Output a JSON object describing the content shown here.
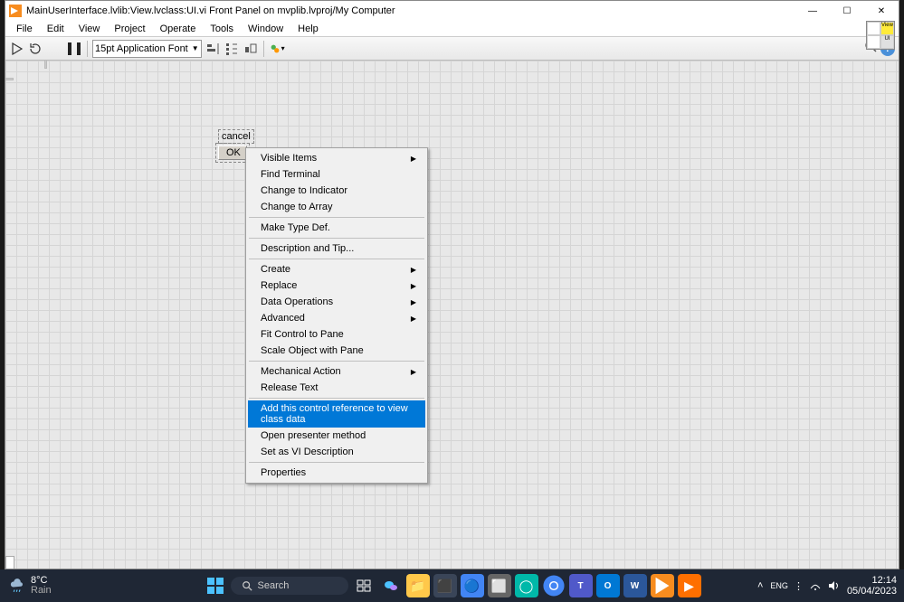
{
  "window": {
    "title": "MainUserInterface.lvlib:View.lvclass:UI.vi Front Panel on mvplib.lvproj/My Computer"
  },
  "menu": {
    "file": "File",
    "edit": "Edit",
    "view": "View",
    "project": "Project",
    "operate": "Operate",
    "tools": "Tools",
    "window": "Window",
    "help": "Help"
  },
  "toolbar": {
    "font_label": "15pt Application Font",
    "palette_top": "View",
    "palette_bottom": "UI"
  },
  "control": {
    "label": "cancel",
    "button": "OK"
  },
  "context_menu": {
    "items": [
      {
        "label": "Visible Items",
        "sub": true
      },
      {
        "label": "Find Terminal"
      },
      {
        "label": "Change to Indicator"
      },
      {
        "label": "Change to Array"
      },
      {
        "sep": true
      },
      {
        "label": "Make Type Def."
      },
      {
        "sep": true
      },
      {
        "label": "Description and Tip..."
      },
      {
        "sep": true
      },
      {
        "label": "Create",
        "sub": true
      },
      {
        "label": "Replace",
        "sub": true
      },
      {
        "label": "Data Operations",
        "sub": true
      },
      {
        "label": "Advanced",
        "sub": true
      },
      {
        "label": "Fit Control to Pane"
      },
      {
        "label": "Scale Object with Pane"
      },
      {
        "sep": true
      },
      {
        "label": "Mechanical Action",
        "sub": true
      },
      {
        "label": "Release Text"
      },
      {
        "sep": true
      },
      {
        "label": "Add this control reference to view class data",
        "hl": true
      },
      {
        "label": "Open presenter method"
      },
      {
        "label": "Set as VI Description"
      },
      {
        "sep": true
      },
      {
        "label": "Properties"
      }
    ]
  },
  "taskbar": {
    "temp": "8°C",
    "weather": "Rain",
    "search_placeholder": "Search",
    "time": "12:14",
    "date": "05/04/2023"
  }
}
